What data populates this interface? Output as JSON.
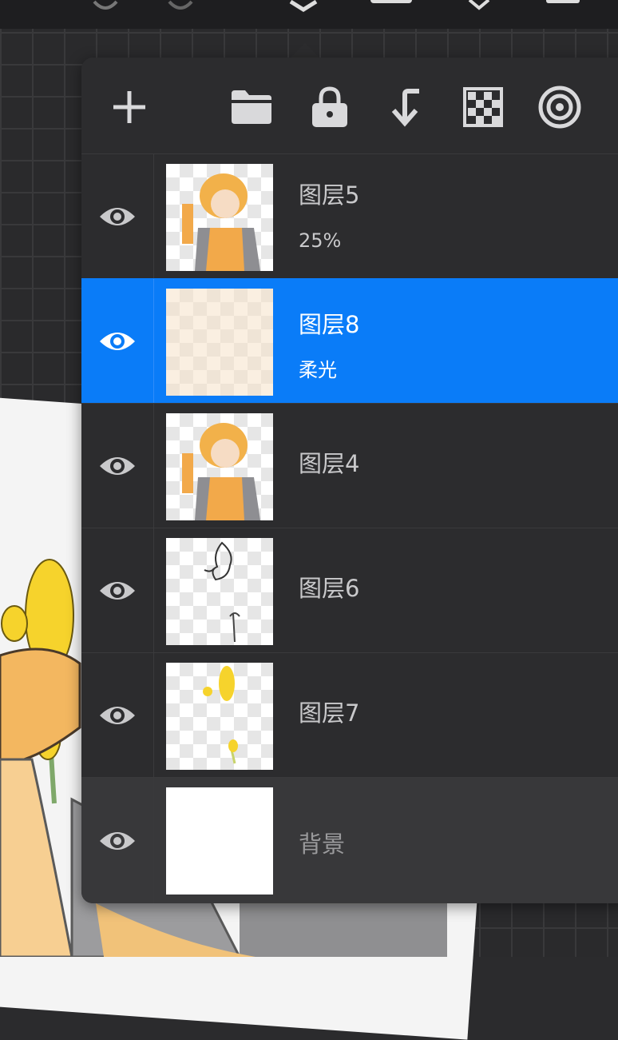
{
  "panel": {
    "toolbar": [
      {
        "name": "add-layer-icon",
        "symbol": "plus"
      },
      {
        "name": "folder-icon",
        "symbol": "folder"
      },
      {
        "name": "lock-icon",
        "symbol": "lock"
      },
      {
        "name": "merge-down-icon",
        "symbol": "arrow-down-left"
      },
      {
        "name": "transparency-icon",
        "symbol": "checker"
      },
      {
        "name": "mask-icon",
        "symbol": "concentric-circles"
      }
    ],
    "layers": [
      {
        "name": "图层5",
        "subtitle": "25%",
        "selected": false
      },
      {
        "name": "图层8",
        "subtitle": "柔光",
        "selected": true
      },
      {
        "name": "图层4",
        "subtitle": "",
        "selected": false
      },
      {
        "name": "图层6",
        "subtitle": "",
        "selected": false
      },
      {
        "name": "图层7",
        "subtitle": "",
        "selected": false
      },
      {
        "name": "背景",
        "subtitle": "",
        "selected": false
      }
    ]
  },
  "colors": {
    "accent": "#0a7cf8",
    "panel_bg": "#2c2c2e",
    "text": "#c9c9cb"
  }
}
